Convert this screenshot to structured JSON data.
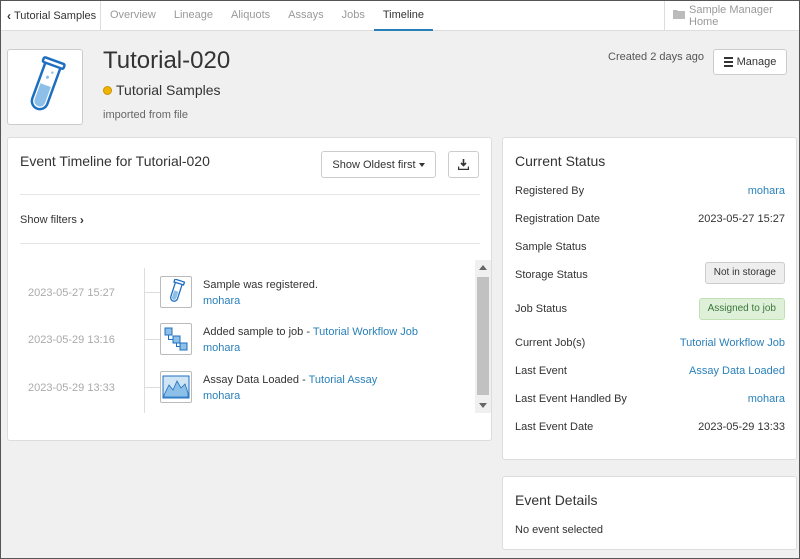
{
  "nav": {
    "back_label": "Tutorial Samples",
    "tabs": [
      {
        "label": "Overview"
      },
      {
        "label": "Lineage"
      },
      {
        "label": "Aliquots"
      },
      {
        "label": "Assays"
      },
      {
        "label": "Jobs"
      },
      {
        "label": "Timeline"
      }
    ],
    "active_tab": "Timeline",
    "home_label": "Sample Manager Home"
  },
  "header": {
    "title": "Tutorial-020",
    "sample_type": "Tutorial Samples",
    "sample_type_color": "#f0b400",
    "subtitle": "imported from file",
    "created": "Created 2 days ago",
    "manage_label": "Manage"
  },
  "timeline": {
    "title": "Event Timeline for Tutorial-020",
    "sort_label": "Show Oldest first",
    "show_filters_label": "Show filters",
    "events": [
      {
        "time": "2023-05-27 15:27",
        "icon": "test-tube-icon",
        "text": "Sample was registered.",
        "link": "",
        "user": "mohara"
      },
      {
        "time": "2023-05-29 13:16",
        "icon": "workflow-icon",
        "text": "Added sample to job - ",
        "link": "Tutorial Workflow Job",
        "user": "mohara"
      },
      {
        "time": "2023-05-29 13:33",
        "icon": "assay-chart-icon",
        "text": "Assay Data Loaded - ",
        "link": "Tutorial Assay",
        "user": "mohara"
      }
    ]
  },
  "status": {
    "title": "Current Status",
    "rows": [
      {
        "label": "Registered By",
        "value": "mohara"
      },
      {
        "label": "Registration Date",
        "value": "2023-05-27 15:27"
      },
      {
        "label": "Sample Status",
        "value": ""
      },
      {
        "label": "Storage Status",
        "value": "Not in storage"
      },
      {
        "label": "Job Status",
        "value": "Assigned to job"
      },
      {
        "label": "Current Job(s)",
        "value": "Tutorial Workflow Job"
      },
      {
        "label": "Last Event",
        "value": "Assay Data Loaded"
      },
      {
        "label": "Last Event Handled By",
        "value": "mohara"
      },
      {
        "label": "Last Event Date",
        "value": "2023-05-29 13:33"
      }
    ]
  },
  "details": {
    "title": "Event Details",
    "empty_text": "No event selected"
  },
  "colors": {
    "link": "#2980b9",
    "accent_tab": "#2980b9",
    "job_badge_bg": "#dff0d8"
  }
}
